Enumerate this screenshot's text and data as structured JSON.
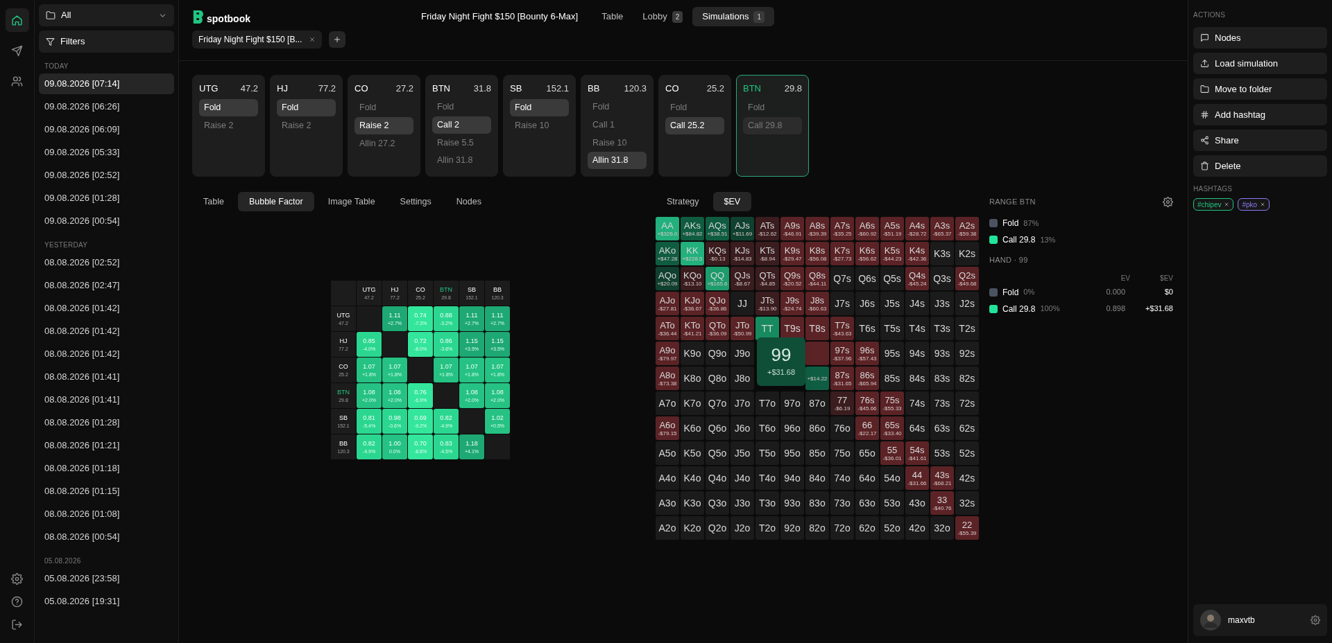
{
  "nav_rail": [
    {
      "selected": true
    },
    {
      "selected": false
    },
    {
      "selected": false
    }
  ],
  "filter_dropdown": {
    "value": "All"
  },
  "filters_button": "Filters",
  "sessions": [
    {
      "heading": "TODAY",
      "items": [
        {
          "label": "09.08.2026 [07:14]",
          "selected": true
        },
        {
          "label": "09.08.2026 [06:26]",
          "selected": false
        },
        {
          "label": "09.08.2026 [06:09]",
          "selected": false
        },
        {
          "label": "09.08.2026 [05:33]",
          "selected": false
        },
        {
          "label": "09.08.2026 [02:52]",
          "selected": false
        },
        {
          "label": "09.08.2026 [01:28]",
          "selected": false
        },
        {
          "label": "09.08.2026 [00:54]",
          "selected": false
        }
      ]
    },
    {
      "heading": "YESTERDAY",
      "items": [
        {
          "label": "08.08.2026 [02:52]",
          "selected": false
        },
        {
          "label": "08.08.2026 [02:47]",
          "selected": false
        },
        {
          "label": "08.08.2026 [01:42]",
          "selected": false
        },
        {
          "label": "08.08.2026 [01:42]",
          "selected": false
        },
        {
          "label": "08.08.2026 [01:42]",
          "selected": false
        },
        {
          "label": "08.08.2026 [01:41]",
          "selected": false
        },
        {
          "label": "08.08.2026 [01:41]",
          "selected": false
        },
        {
          "label": "08.08.2026 [01:28]",
          "selected": false
        },
        {
          "label": "08.08.2026 [01:21]",
          "selected": false
        },
        {
          "label": "08.08.2026 [01:18]",
          "selected": false
        },
        {
          "label": "08.08.2026 [01:15]",
          "selected": false
        },
        {
          "label": "08.08.2026 [01:08]",
          "selected": false
        },
        {
          "label": "08.08.2026 [00:54]",
          "selected": false
        }
      ]
    },
    {
      "heading": "05.08.2026",
      "items": [
        {
          "label": "05.08.2026 [23:58]",
          "selected": false
        },
        {
          "label": "05.08.2026 [19:31]",
          "selected": false
        }
      ]
    }
  ],
  "logo": "spotbook",
  "tournament_title": "Friday Night Fight $150 [Bounty 6-Max]",
  "top_tabs": [
    {
      "label": "Table",
      "selected": false
    },
    {
      "label": "Lobby",
      "badge": "2",
      "selected": false
    },
    {
      "label": "Simulations",
      "badge": "1",
      "selected": true
    }
  ],
  "open_tab": {
    "label": "Friday Night Fight $150 [B..."
  },
  "action_cards": [
    {
      "position": "UTG",
      "stack": "47.2",
      "current": false,
      "actions": [
        {
          "label": "Fold",
          "chosen": true
        },
        {
          "label": "Raise 2",
          "chosen": false
        }
      ]
    },
    {
      "position": "HJ",
      "stack": "77.2",
      "current": false,
      "actions": [
        {
          "label": "Fold",
          "chosen": true
        },
        {
          "label": "Raise 2",
          "chosen": false
        }
      ]
    },
    {
      "position": "CO",
      "stack": "27.2",
      "current": false,
      "actions": [
        {
          "label": "Fold",
          "chosen": false
        },
        {
          "label": "Raise 2",
          "chosen": true
        },
        {
          "label": "Allin 27.2",
          "chosen": false
        }
      ]
    },
    {
      "position": "BTN",
      "stack": "31.8",
      "current": false,
      "actions": [
        {
          "label": "Fold",
          "chosen": false
        },
        {
          "label": "Call 2",
          "chosen": true
        },
        {
          "label": "Raise 5.5",
          "chosen": false
        },
        {
          "label": "Allin 31.8",
          "chosen": false
        }
      ]
    },
    {
      "position": "SB",
      "stack": "152.1",
      "current": false,
      "actions": [
        {
          "label": "Fold",
          "chosen": true
        },
        {
          "label": "Raise 10",
          "chosen": false
        }
      ]
    },
    {
      "position": "BB",
      "stack": "120.3",
      "current": false,
      "actions": [
        {
          "label": "Fold",
          "chosen": false
        },
        {
          "label": "Call 1",
          "chosen": false
        },
        {
          "label": "Raise 10",
          "chosen": false
        },
        {
          "label": "Allin 31.8",
          "chosen": true
        }
      ]
    },
    {
      "position": "CO",
      "stack": "25.2",
      "current": false,
      "actions": [
        {
          "label": "Fold",
          "chosen": false
        },
        {
          "label": "Call 25.2",
          "chosen": true
        }
      ]
    },
    {
      "position": "BTN",
      "stack": "29.8",
      "current": true,
      "actions": [
        {
          "label": "Fold",
          "chosen": false
        },
        {
          "label": "Call 29.8",
          "chosen": true
        }
      ]
    }
  ],
  "view_tabs": [
    {
      "label": "Table",
      "selected": false
    },
    {
      "label": "Bubble Factor",
      "selected": true
    },
    {
      "label": "Image Table",
      "selected": false
    },
    {
      "label": "Settings",
      "selected": false
    },
    {
      "label": "Nodes",
      "selected": false
    }
  ],
  "bubble_factor": {
    "columns": [
      {
        "position": "UTG",
        "stack": "47.2",
        "highlight": false
      },
      {
        "position": "HJ",
        "stack": "77.2",
        "highlight": false
      },
      {
        "position": "CO",
        "stack": "25.2",
        "highlight": false
      },
      {
        "position": "BTN",
        "stack": "29.8",
        "highlight": true
      },
      {
        "position": "SB",
        "stack": "152.1",
        "highlight": false
      },
      {
        "position": "BB",
        "stack": "120.3",
        "highlight": false
      }
    ],
    "rows": [
      {
        "position": "UTG",
        "stack": "47.2",
        "highlight": false,
        "cells": [
          {
            "kind": "empty"
          },
          {
            "kind": "value",
            "value": "1.11",
            "change": "+2.7%",
            "color": "#1ea874"
          },
          {
            "kind": "value",
            "value": "0.74",
            "change": "-7.3%",
            "color": "#33e69c"
          },
          {
            "kind": "value",
            "value": "0.88",
            "change": "-3.2%",
            "color": "#2bd790"
          },
          {
            "kind": "value",
            "value": "1.11",
            "change": "+2.7%",
            "color": "#1ea874"
          },
          {
            "kind": "value",
            "value": "1.11",
            "change": "+2.7%",
            "color": "#1ea874"
          }
        ]
      },
      {
        "position": "HJ",
        "stack": "77.2",
        "highlight": false,
        "cells": [
          {
            "kind": "value",
            "value": "0.85",
            "change": "-4.0%",
            "color": "#2bd790"
          },
          {
            "kind": "empty"
          },
          {
            "kind": "value",
            "value": "0.72",
            "change": "-8.0%",
            "color": "#33e69c"
          },
          {
            "kind": "value",
            "value": "0.86",
            "change": "-3.8%",
            "color": "#2bd790"
          },
          {
            "kind": "value",
            "value": "1.15",
            "change": "+3.5%",
            "color": "#1ea874"
          },
          {
            "kind": "value",
            "value": "1.15",
            "change": "+3.5%",
            "color": "#1ea874"
          }
        ]
      },
      {
        "position": "CO",
        "stack": "25.2",
        "highlight": false,
        "cells": [
          {
            "kind": "value",
            "value": "1.07",
            "change": "+1.8%",
            "color": "#25c283"
          },
          {
            "kind": "value",
            "value": "1.07",
            "change": "+1.8%",
            "color": "#25c283"
          },
          {
            "kind": "empty"
          },
          {
            "kind": "value",
            "value": "1.07",
            "change": "+1.8%",
            "color": "#25c283"
          },
          {
            "kind": "value",
            "value": "1.07",
            "change": "+1.8%",
            "color": "#25c283"
          },
          {
            "kind": "value",
            "value": "1.07",
            "change": "+1.8%",
            "color": "#25c283"
          }
        ]
      },
      {
        "position": "BTN",
        "stack": "29.8",
        "highlight": true,
        "cells": [
          {
            "kind": "value",
            "value": "1.08",
            "change": "+2.0%",
            "color": "#25c283"
          },
          {
            "kind": "value",
            "value": "1.08",
            "change": "+2.0%",
            "color": "#25c283"
          },
          {
            "kind": "value",
            "value": "0.76",
            "change": "-6.9%",
            "color": "#33e69c"
          },
          {
            "kind": "empty"
          },
          {
            "kind": "value",
            "value": "1.08",
            "change": "+2.0%",
            "color": "#25c283"
          },
          {
            "kind": "value",
            "value": "1.08",
            "change": "+2.0%",
            "color": "#25c283"
          }
        ]
      },
      {
        "position": "SB",
        "stack": "152.1",
        "highlight": false,
        "cells": [
          {
            "kind": "value",
            "value": "0.81",
            "change": "-5.4%",
            "color": "#2bd790"
          },
          {
            "kind": "value",
            "value": "0.98",
            "change": "-0.6%",
            "color": "#2bd790"
          },
          {
            "kind": "value",
            "value": "0.69",
            "change": "-9.2%",
            "color": "#33e69c"
          },
          {
            "kind": "value",
            "value": "0.82",
            "change": "-4.9%",
            "color": "#2bd790"
          },
          {
            "kind": "empty"
          },
          {
            "kind": "value",
            "value": "1.02",
            "change": "+0.5%",
            "color": "#25c283"
          }
        ]
      },
      {
        "position": "BB",
        "stack": "120.3",
        "highlight": false,
        "cells": [
          {
            "kind": "value",
            "value": "0.82",
            "change": "-4.9%",
            "color": "#2bd790"
          },
          {
            "kind": "value",
            "value": "1.00",
            "change": "0.0%",
            "color": "#25c283"
          },
          {
            "kind": "value",
            "value": "0.70",
            "change": "-8.8%",
            "color": "#33e69c"
          },
          {
            "kind": "value",
            "value": "0.83",
            "change": "-4.5%",
            "color": "#2bd790"
          },
          {
            "kind": "value",
            "value": "1.18",
            "change": "+4.1%",
            "color": "#1ea874"
          },
          {
            "kind": "empty"
          }
        ]
      }
    ]
  },
  "range_tabs": [
    {
      "label": "Strategy",
      "selected": false
    },
    {
      "label": "$EV",
      "selected": true
    }
  ],
  "range_grid": {
    "rows": [
      [
        {
          "hand": "AA",
          "ev": "+$326.0",
          "color": "#22b07c"
        },
        {
          "hand": "AKs",
          "ev": "+$84.82",
          "color": "#0f5c41"
        },
        {
          "hand": "AQs",
          "ev": "+$38.51",
          "color": "#0f5c41"
        },
        {
          "hand": "AJs",
          "ev": "+$11.69",
          "color": "#10402f"
        },
        {
          "hand": "ATs",
          "ev": "-$12.62",
          "color": "#3b1d1f"
        },
        {
          "hand": "A9s",
          "ev": "-$46.91",
          "color": "#5b2326"
        },
        {
          "hand": "A8s",
          "ev": "-$39.39",
          "color": "#5b2326"
        },
        {
          "hand": "A7s",
          "ev": "-$35.25",
          "color": "#5b2326"
        },
        {
          "hand": "A6s",
          "ev": "-$60.92",
          "color": "#5b2326"
        },
        {
          "hand": "A5s",
          "ev": "-$51.19",
          "color": "#5b2326"
        },
        {
          "hand": "A4s",
          "ev": "-$28.72",
          "color": "#5b2326"
        },
        {
          "hand": "A3s",
          "ev": "-$65.37",
          "color": "#5b2326"
        },
        {
          "hand": "A2s",
          "ev": "-$59.38",
          "color": "#5b2326"
        }
      ],
      [
        {
          "hand": "AKo",
          "ev": "+$47.28",
          "color": "#0f5c41"
        },
        {
          "hand": "KK",
          "ev": "+$228.5",
          "color": "#22b07c"
        },
        {
          "hand": "KQs",
          "ev": "-$0.13",
          "color": "#3b1d1f"
        },
        {
          "hand": "KJs",
          "ev": "-$14.83",
          "color": "#3b1d1f"
        },
        {
          "hand": "KTs",
          "ev": "-$8.94",
          "color": "#3b1d1f"
        },
        {
          "hand": "K9s",
          "ev": "-$29.47",
          "color": "#5b2326"
        },
        {
          "hand": "K8s",
          "ev": "-$56.08",
          "color": "#5b2326"
        },
        {
          "hand": "K7s",
          "ev": "-$27.73",
          "color": "#5b2326"
        },
        {
          "hand": "K6s",
          "ev": "-$56.62",
          "color": "#5b2326"
        },
        {
          "hand": "K5s",
          "ev": "-$44.23",
          "color": "#5b2326"
        },
        {
          "hand": "K4s",
          "ev": "-$42.36",
          "color": "#5b2326"
        },
        {
          "hand": "K3s"
        },
        {
          "hand": "K2s"
        }
      ],
      [
        {
          "hand": "AQo",
          "ev": "+$20.09",
          "color": "#10402f"
        },
        {
          "hand": "KQo",
          "ev": "-$13.10",
          "color": "#3b1d1f"
        },
        {
          "hand": "QQ",
          "ev": "+$165.6",
          "color": "#1d9c6c"
        },
        {
          "hand": "QJs",
          "ev": "-$8.67",
          "color": "#3b1d1f"
        },
        {
          "hand": "QTs",
          "ev": "-$4.85",
          "color": "#3b1d1f"
        },
        {
          "hand": "Q9s",
          "ev": "-$20.52",
          "color": "#5b2326"
        },
        {
          "hand": "Q8s",
          "ev": "-$44.11",
          "color": "#5b2326"
        },
        {
          "hand": "Q7s"
        },
        {
          "hand": "Q6s"
        },
        {
          "hand": "Q5s"
        },
        {
          "hand": "Q4s",
          "ev": "-$45.24",
          "color": "#5b2326"
        },
        {
          "hand": "Q3s"
        },
        {
          "hand": "Q2s",
          "ev": "-$49.68",
          "color": "#5b2326"
        }
      ],
      [
        {
          "hand": "AJo",
          "ev": "-$27.81",
          "color": "#5b2326"
        },
        {
          "hand": "KJo",
          "ev": "-$36.67",
          "color": "#5b2326"
        },
        {
          "hand": "QJo",
          "ev": "-$36.86",
          "color": "#5b2326"
        },
        {
          "hand": "JJ"
        },
        {
          "hand": "JTs",
          "ev": "-$13.90",
          "color": "#3b1d1f"
        },
        {
          "hand": "J9s",
          "ev": "-$24.74",
          "color": "#5b2326"
        },
        {
          "hand": "J8s",
          "ev": "-$60.63",
          "color": "#5b2326"
        },
        {
          "hand": "J7s"
        },
        {
          "hand": "J6s"
        },
        {
          "hand": "J5s"
        },
        {
          "hand": "J4s"
        },
        {
          "hand": "J3s"
        },
        {
          "hand": "J2s"
        }
      ],
      [
        {
          "hand": "ATo",
          "ev": "-$36.44",
          "color": "#5b2326"
        },
        {
          "hand": "KTo",
          "ev": "-$41.21",
          "color": "#5b2326"
        },
        {
          "hand": "QTo",
          "ev": "-$36.09",
          "color": "#5b2326"
        },
        {
          "hand": "JTo",
          "ev": "-$50.99",
          "color": "#5b2326"
        },
        {
          "hand": "TT",
          "color": "#178a5f"
        },
        {
          "hand": "T9s",
          "color": "#5b2326"
        },
        {
          "hand": "T8s",
          "color": "#5b2326"
        },
        {
          "hand": "T7s",
          "ev": "-$43.63",
          "color": "#5b2326"
        },
        {
          "hand": "T6s"
        },
        {
          "hand": "T5s"
        },
        {
          "hand": "T4s"
        },
        {
          "hand": "T3s"
        },
        {
          "hand": "T2s"
        }
      ],
      [
        {
          "hand": "A9o",
          "ev": "-$79.97",
          "color": "#5b2326"
        },
        {
          "hand": "K9o"
        },
        {
          "hand": "Q9o"
        },
        {
          "hand": "J9o"
        },
        {
          "kind": "covered"
        },
        {
          "kind": "covered"
        },
        {
          "color": "#5b2326"
        },
        {
          "hand": "97s",
          "ev": "-$37.96",
          "color": "#5b2326"
        },
        {
          "hand": "96s",
          "ev": "-$57.43",
          "color": "#5b2326"
        },
        {
          "hand": "95s"
        },
        {
          "hand": "94s"
        },
        {
          "hand": "93s"
        },
        {
          "hand": "92s"
        }
      ],
      [
        {
          "hand": "A8o",
          "ev": "-$73.38",
          "color": "#5b2326"
        },
        {
          "hand": "K8o"
        },
        {
          "hand": "Q8o"
        },
        {
          "hand": "J8o"
        },
        {
          "kind": "covered"
        },
        {
          "kind": "covered"
        },
        {
          "ev": "+$14.22",
          "color": "#0f5e43"
        },
        {
          "hand": "87s",
          "ev": "-$31.65",
          "color": "#5b2326"
        },
        {
          "hand": "86s",
          "ev": "-$65.94",
          "color": "#5b2326"
        },
        {
          "hand": "85s"
        },
        {
          "hand": "84s"
        },
        {
          "hand": "83s"
        },
        {
          "hand": "82s"
        }
      ],
      [
        {
          "hand": "A7o"
        },
        {
          "hand": "K7o"
        },
        {
          "hand": "Q7o"
        },
        {
          "hand": "J7o"
        },
        {
          "hand": "T7o"
        },
        {
          "hand": "97o"
        },
        {
          "hand": "87o"
        },
        {
          "hand": "77",
          "ev": "-$6.19",
          "color": "#3b1d1f"
        },
        {
          "hand": "76s",
          "ev": "-$45.66",
          "color": "#5b2326"
        },
        {
          "hand": "75s",
          "ev": "-$55.33",
          "color": "#5b2326"
        },
        {
          "hand": "74s"
        },
        {
          "hand": "73s"
        },
        {
          "hand": "72s"
        }
      ],
      [
        {
          "hand": "A6o",
          "ev": "-$79.15",
          "color": "#5b2326"
        },
        {
          "hand": "K6o"
        },
        {
          "hand": "Q6o"
        },
        {
          "hand": "J6o"
        },
        {
          "hand": "T6o"
        },
        {
          "hand": "96o"
        },
        {
          "hand": "86o"
        },
        {
          "hand": "76o"
        },
        {
          "hand": "66",
          "ev": "-$22.17",
          "color": "#5b2326"
        },
        {
          "hand": "65s",
          "ev": "-$33.40",
          "color": "#5b2326"
        },
        {
          "hand": "64s"
        },
        {
          "hand": "63s"
        },
        {
          "hand": "62s"
        }
      ],
      [
        {
          "hand": "A5o"
        },
        {
          "hand": "K5o"
        },
        {
          "hand": "Q5o"
        },
        {
          "hand": "J5o"
        },
        {
          "hand": "T5o"
        },
        {
          "hand": "95o"
        },
        {
          "hand": "85o"
        },
        {
          "hand": "75o"
        },
        {
          "hand": "65o"
        },
        {
          "hand": "55",
          "ev": "-$36.01",
          "color": "#5b2326"
        },
        {
          "hand": "54s",
          "ev": "-$41.61",
          "color": "#5b2326"
        },
        {
          "hand": "53s"
        },
        {
          "hand": "52s"
        }
      ],
      [
        {
          "hand": "A4o"
        },
        {
          "hand": "K4o"
        },
        {
          "hand": "Q4o"
        },
        {
          "hand": "J4o"
        },
        {
          "hand": "T4o"
        },
        {
          "hand": "94o"
        },
        {
          "hand": "84o"
        },
        {
          "hand": "74o"
        },
        {
          "hand": "64o"
        },
        {
          "hand": "54o"
        },
        {
          "hand": "44",
          "ev": "-$31.66",
          "color": "#5b2326"
        },
        {
          "hand": "43s",
          "ev": "-$68.21",
          "color": "#5b2326"
        },
        {
          "hand": "42s"
        }
      ],
      [
        {
          "hand": "A3o"
        },
        {
          "hand": "K3o"
        },
        {
          "hand": "Q3o"
        },
        {
          "hand": "J3o"
        },
        {
          "hand": "T3o"
        },
        {
          "hand": "93o"
        },
        {
          "hand": "83o"
        },
        {
          "hand": "73o"
        },
        {
          "hand": "63o"
        },
        {
          "hand": "53o"
        },
        {
          "hand": "43o"
        },
        {
          "hand": "33",
          "ev": "-$40.76",
          "color": "#5b2326"
        },
        {
          "hand": "32s"
        }
      ],
      [
        {
          "hand": "A2o"
        },
        {
          "hand": "K2o"
        },
        {
          "hand": "Q2o"
        },
        {
          "hand": "J2o"
        },
        {
          "hand": "T2o"
        },
        {
          "hand": "92o"
        },
        {
          "hand": "82o"
        },
        {
          "hand": "72o"
        },
        {
          "hand": "62o"
        },
        {
          "hand": "52o"
        },
        {
          "hand": "42o"
        },
        {
          "hand": "32o"
        },
        {
          "hand": "22",
          "ev": "-$55.39",
          "color": "#5b2326"
        }
      ]
    ]
  },
  "hand_tooltip": {
    "hand": "99",
    "ev": "+$31.68"
  },
  "range_legend": {
    "title": "RANGE BTN",
    "items": [
      {
        "label": "Fold",
        "share": "87%",
        "color": "#4b5361"
      },
      {
        "label": "Call 29.8",
        "share": "13%",
        "color": "#22e39a"
      }
    ]
  },
  "hand_info": {
    "title": "HAND · 99",
    "columns": [
      "EV",
      "$EV"
    ],
    "rows": [
      {
        "label": "Fold",
        "share": "0%",
        "ev": "0.000",
        "dollar_ev": "$0",
        "color": "#4b5361"
      },
      {
        "label": "Call 29.8",
        "share": "100%",
        "ev": "0.898",
        "dollar_ev": "+$31.68",
        "color": "#22e39a"
      }
    ]
  },
  "actions_heading": "ACTIONS",
  "actions": [
    "Nodes",
    "Load simulation",
    "Move to folder",
    "Add hashtag",
    "Share",
    "Delete"
  ],
  "hashtags_heading": "HASHTAGS",
  "hashtags": [
    {
      "label": "#chipev",
      "color": "#22c583"
    },
    {
      "label": "#pko",
      "color": "#8b7cf6"
    }
  ],
  "user": {
    "name": "maxvtb"
  }
}
